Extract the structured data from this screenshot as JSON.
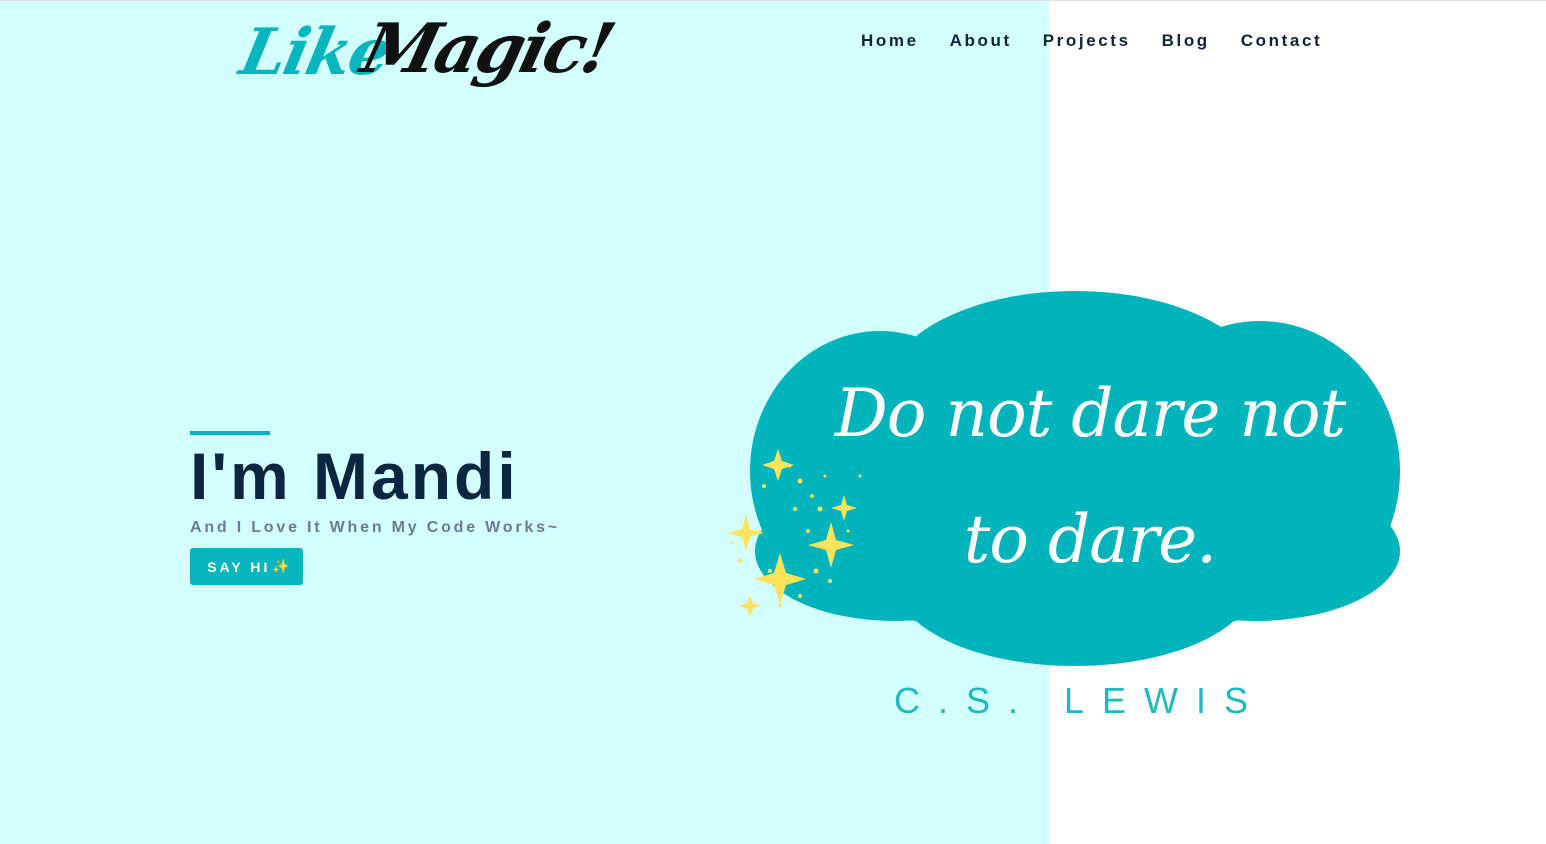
{
  "logo": {
    "word1": "Like",
    "word2": "Magic!"
  },
  "nav": {
    "items": [
      {
        "label": "Home"
      },
      {
        "label": "About"
      },
      {
        "label": "Projects"
      },
      {
        "label": "Blog"
      },
      {
        "label": "Contact"
      }
    ]
  },
  "hero": {
    "title": "I'm Mandi",
    "subtitle": "And I Love It When My Code Works~",
    "cta_label": "SAY HI",
    "cta_icon": "sparkles-icon"
  },
  "quote": {
    "text": "Do not dare not to dare.",
    "author": "C.S. LEWIS"
  },
  "colors": {
    "accent": "#06b5bd",
    "hero_background": "#d4ffff",
    "heading": "#0c2541",
    "subtitle": "#6c7b94",
    "sparkle": "#ffe45c"
  }
}
